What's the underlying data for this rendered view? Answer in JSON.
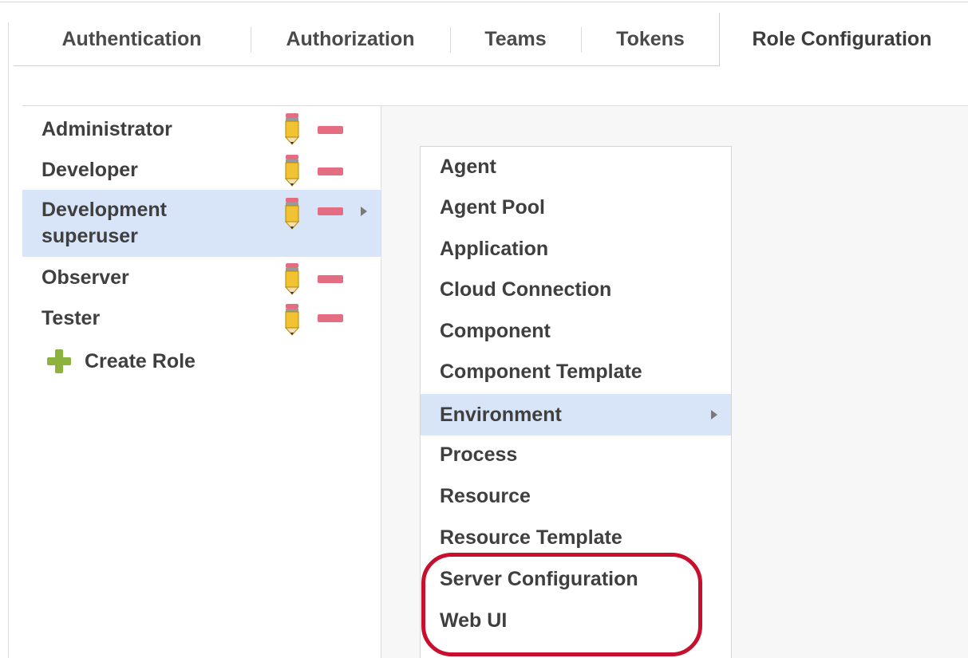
{
  "tabs": [
    {
      "label": "Authentication",
      "active": false
    },
    {
      "label": "Authorization",
      "active": false
    },
    {
      "label": "Teams",
      "active": false
    },
    {
      "label": "Tokens",
      "active": false
    },
    {
      "label": "Role Configuration",
      "active": true
    }
  ],
  "roles": {
    "items": [
      {
        "label": "Administrator",
        "selected": false
      },
      {
        "label": "Developer",
        "selected": false
      },
      {
        "label": "Development superuser",
        "line1": "Development",
        "line2": "superuser",
        "selected": true
      },
      {
        "label": "Observer",
        "selected": false
      },
      {
        "label": "Tester",
        "selected": false
      }
    ],
    "create_label": "Create Role"
  },
  "menu": {
    "items": [
      {
        "label": "Agent"
      },
      {
        "label": "Agent Pool"
      },
      {
        "label": "Application"
      },
      {
        "label": "Cloud Connection"
      },
      {
        "label": "Component"
      },
      {
        "label": "Component Template"
      },
      {
        "label": "Environment",
        "highlighted": true,
        "has_submenu": true
      },
      {
        "label": "Process"
      },
      {
        "label": "Resource"
      },
      {
        "label": "Resource Template"
      },
      {
        "label": "Server Configuration"
      },
      {
        "label": "Web UI"
      }
    ]
  },
  "icons": {
    "edit": "pencil-icon",
    "delete": "minus-icon",
    "add": "plus-icon",
    "submenu": "chevron-right-icon"
  },
  "colors": {
    "selection": "#d8e4f8",
    "delete": "#e46d82",
    "add": "#8db33e",
    "annotation": "#c8102e"
  }
}
